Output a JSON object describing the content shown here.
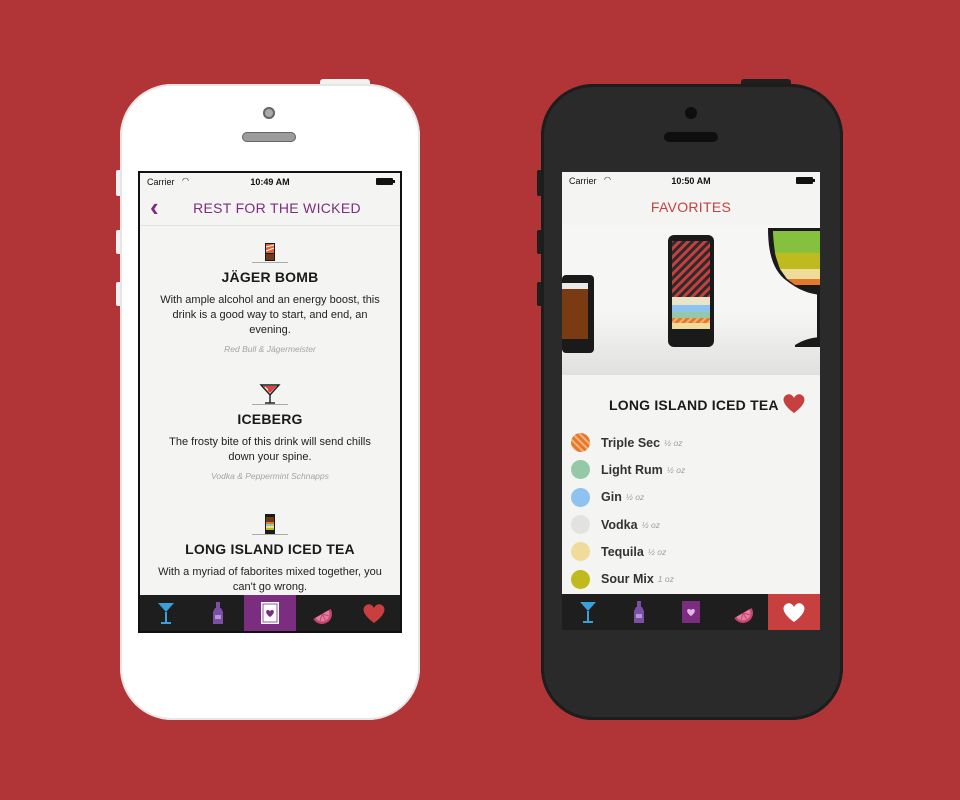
{
  "left_phone": {
    "status": {
      "carrier": "Carrier",
      "time": "10:49 AM"
    },
    "nav": {
      "back_icon": "chevron-left-icon",
      "title": "REST FOR THE WICKED"
    },
    "drinks": [
      {
        "icon": "shot-glass-icon",
        "name": "JÄGER BOMB",
        "description": "With ample alcohol and an energy boost, this drink is a good way to start, and end, an evening.",
        "ingredients": "Red Bull & Jägermeister"
      },
      {
        "icon": "martini-glass-icon",
        "name": "ICEBERG",
        "description": "The frosty bite of this drink will send chills down your spine.",
        "ingredients": "Vodka & Peppermint Schnapps"
      },
      {
        "icon": "highball-glass-icon",
        "name": "LONG ISLAND ICED TEA",
        "description": "With a myriad of faborites mixed together, you can't go wrong.",
        "ingredients": ""
      }
    ],
    "tabs": [
      {
        "icon": "cocktail-glass-icon",
        "active": false
      },
      {
        "icon": "bottle-icon",
        "active": false
      },
      {
        "icon": "card-heart-icon",
        "active": true
      },
      {
        "icon": "lime-slice-icon",
        "active": false
      },
      {
        "icon": "heart-icon",
        "active": false
      }
    ]
  },
  "right_phone": {
    "status": {
      "carrier": "Carrier",
      "time": "10:50 AM"
    },
    "nav": {
      "title": "FAVORITES"
    },
    "favorite": {
      "name": "LONG ISLAND ICED TEA",
      "heart_icon": "heart-icon",
      "ingredients": [
        {
          "name": "Triple Sec",
          "amount": "½ oz",
          "color": "#e5782a"
        },
        {
          "name": "Light Rum",
          "amount": "½ oz",
          "color": "#93c9a6"
        },
        {
          "name": "Gin",
          "amount": "½ oz",
          "color": "#8fc3ef"
        },
        {
          "name": "Vodka",
          "amount": "½ oz",
          "color": "#e2e2e0"
        },
        {
          "name": "Tequila",
          "amount": "½ oz",
          "color": "#f0dc9a"
        },
        {
          "name": "Sour Mix",
          "amount": "1 oz",
          "color": "#bfba1d"
        }
      ]
    },
    "tabs": [
      {
        "icon": "cocktail-glass-icon",
        "active": false
      },
      {
        "icon": "bottle-icon",
        "active": false
      },
      {
        "icon": "card-heart-icon",
        "active": false
      },
      {
        "icon": "lime-slice-icon",
        "active": false
      },
      {
        "icon": "heart-icon",
        "active": true
      }
    ]
  },
  "colors": {
    "background": "#b13436",
    "accent_purple": "#7b2e80",
    "accent_red": "#c7403f",
    "tab_cocktail": "#3aa0d8",
    "tab_bottle": "#7b4fa6"
  }
}
